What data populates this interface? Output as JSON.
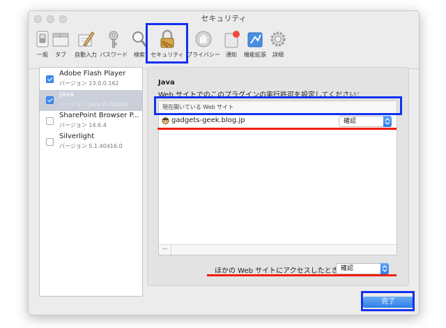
{
  "window": {
    "title": "セキュリティ"
  },
  "toolbar": {
    "items": [
      {
        "label": "一般",
        "icon": "switch-icon"
      },
      {
        "label": "タブ",
        "icon": "tabs-icon"
      },
      {
        "label": "自動入力",
        "icon": "pencil-icon"
      },
      {
        "label": "パスワード",
        "icon": "key-icon"
      },
      {
        "label": "検索",
        "icon": "search-icon"
      },
      {
        "label": "セキュリティ",
        "icon": "lock-icon",
        "selected": true
      },
      {
        "label": "プライバシー",
        "icon": "hand-icon"
      },
      {
        "label": "通知",
        "icon": "notification-icon"
      },
      {
        "label": "機能拡張",
        "icon": "puzzle-icon"
      },
      {
        "label": "詳細",
        "icon": "gear-icon"
      }
    ]
  },
  "plugins": [
    {
      "name": "Adobe Flash Player",
      "version": "バージョン 23.0.0.162",
      "checked": true,
      "selected": false
    },
    {
      "name": "Java",
      "version": "バージョン Java 8 Update",
      "checked": true,
      "selected": true
    },
    {
      "name": "SharePoint Browser P...",
      "version": "バージョン 14.6.4",
      "checked": false,
      "selected": false
    },
    {
      "name": "Silverlight",
      "version": "バージョン 5.1.40416.0",
      "checked": false,
      "selected": false
    }
  ],
  "panel": {
    "title": "Java",
    "description": "Web サイトでのこのプラグインの実行許可を設定してください：",
    "list_header": "現在開いている Web サイト",
    "sites": [
      {
        "name": "gadgets-geek.blog.jp",
        "setting": "確認"
      }
    ],
    "minus_label": "—",
    "other_sites_label": "ほかの Web サイトにアクセスしたとき：",
    "other_sites_setting": "確認"
  },
  "done_button": "完了",
  "colors": {
    "highlight": "#1231f0",
    "underline": "#f01d0e",
    "accent": "#2f7fe8",
    "selection": "#cacfd9"
  }
}
